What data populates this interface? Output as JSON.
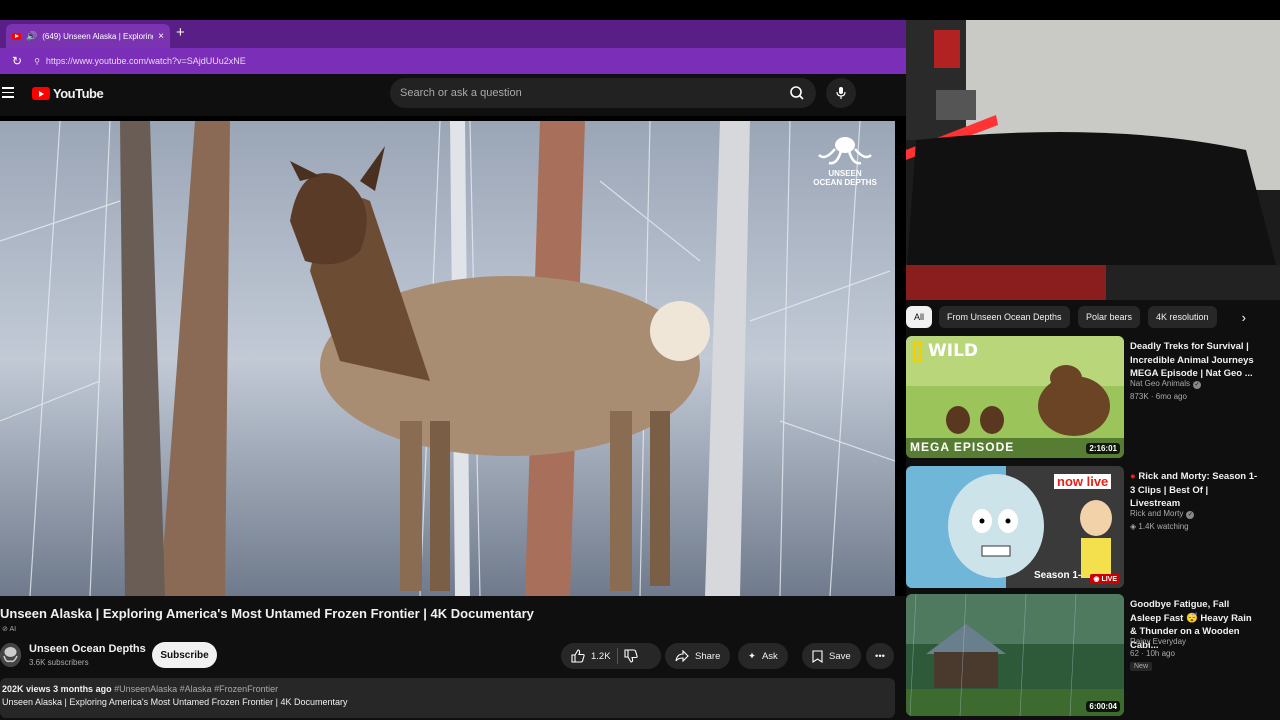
{
  "browser": {
    "tab_title": "(649) Unseen Alaska | Exploring",
    "url": "https://www.youtube.com/watch?v=SAjdUUu2xNE",
    "new_tab": "+",
    "close": "×"
  },
  "header": {
    "logo": "YouTube",
    "search_placeholder": "Search or ask a question"
  },
  "video": {
    "watermark_line1": "UNSEEN",
    "watermark_line2": "OCEAN DEPTHS",
    "title": "Unseen Alaska | Exploring America's Most Untamed Frozen Frontier | 4K Documentary",
    "ai_tag": "AI",
    "channel": "Unseen Ocean Depths",
    "subscribers": "3.6K subscribers",
    "subscribe_label": "Subscribe",
    "likes": "1.2K",
    "share_label": "Share",
    "ask_label": "Ask",
    "save_label": "Save",
    "views": "202K views",
    "age": "3 months ago",
    "hashtags": "#UnseenAlaska #Alaska #FrozenFrontier",
    "description": "Unseen Alaska | Exploring America's Most Untamed Frozen Frontier | 4K Documentary"
  },
  "chips": [
    "All",
    "From Unseen Ocean Depths",
    "Polar bears",
    "4K resolution"
  ],
  "recommendations": [
    {
      "title": "Deadly Treks for Survival | Incredible Animal Journeys MEGA Episode | Nat Geo ...",
      "channel": "Nat Geo Animals",
      "meta": "873K · 6mo ago",
      "duration": "2:16:01",
      "thumb_text1": "WILD",
      "thumb_text2": "MEGA EPISODE"
    },
    {
      "title": "Rick and Morty: Season 1-3 Clips | Best Of | Livestream",
      "channel": "Rick and Morty",
      "meta": "1.4K watching",
      "thumb_text1": "now live",
      "thumb_text2": "Season 1-",
      "live_label": "LIVE"
    },
    {
      "title": "Goodbye Fatigue, Fall Asleep Fast 😴 Heavy Rain & Thunder on a Wooden Cabi...",
      "channel": "Rainy Everyday",
      "meta": "62 · 10h ago",
      "badge": "New",
      "duration": "6:00:04"
    }
  ],
  "colors": {
    "tabstrip": "#5a1f86",
    "addressbar": "#7b2fb8",
    "youtube_red": "#ff0000",
    "background": "#0f0f0f"
  }
}
